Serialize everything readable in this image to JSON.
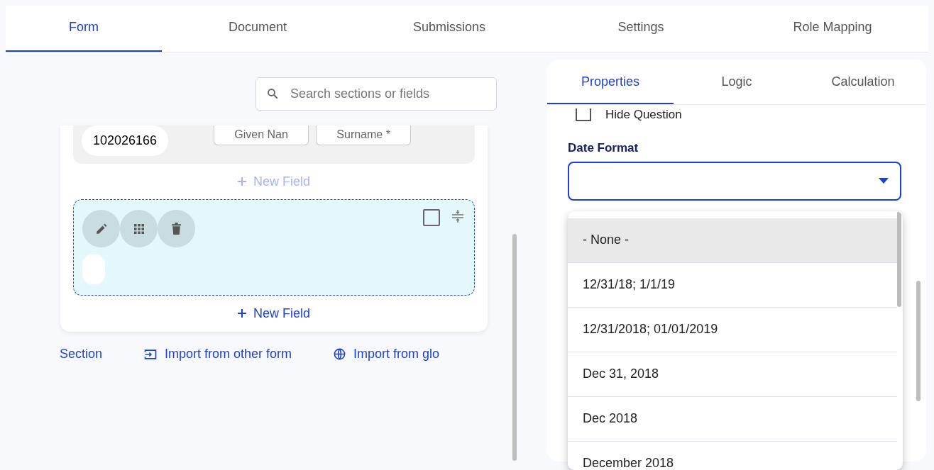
{
  "tabs": [
    {
      "label": "Form",
      "selected": true
    },
    {
      "label": "Document",
      "selected": false
    },
    {
      "label": "Submissions",
      "selected": false
    },
    {
      "label": "Settings",
      "selected": false
    },
    {
      "label": "Role Mapping",
      "selected": false
    }
  ],
  "search": {
    "placeholder": "Search sections or fields"
  },
  "form_card": {
    "id_value": "102026166",
    "name_fields": [
      "Given Nan",
      "Surname *"
    ],
    "new_field_faded": "New Field",
    "new_field": "New Field",
    "checkbox_checked": false
  },
  "footer_links": [
    {
      "label": "Section",
      "kind": "plain"
    },
    {
      "label": "Import from other form",
      "kind": "import"
    },
    {
      "label": "Import from glo",
      "kind": "globe"
    }
  ],
  "properties_tabs": [
    {
      "label": "Properties",
      "selected": true
    },
    {
      "label": "Logic",
      "selected": false
    },
    {
      "label": "Calculation",
      "selected": false
    }
  ],
  "hide_question": {
    "label": "Hide Question",
    "checked": false
  },
  "date_format": {
    "label": "Date Format",
    "options": [
      {
        "label": "- None -",
        "selected": true
      },
      {
        "label": "12/31/18; 1/1/19",
        "selected": false
      },
      {
        "label": "12/31/2018; 01/01/2019",
        "selected": false
      },
      {
        "label": "Dec 31, 2018",
        "selected": false
      },
      {
        "label": "Dec 2018",
        "selected": false
      },
      {
        "label": "December 2018",
        "selected": false
      }
    ]
  }
}
